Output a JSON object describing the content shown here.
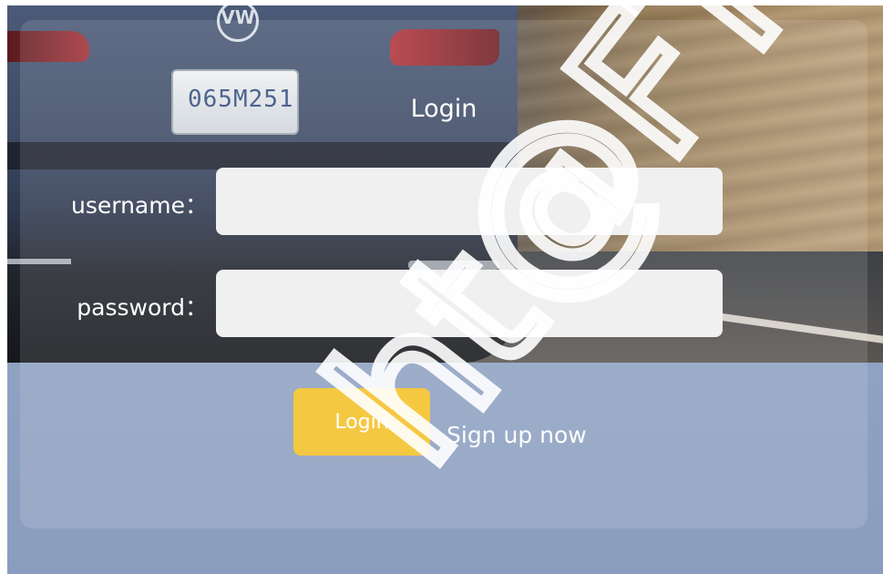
{
  "background": {
    "plate_text": "065M251",
    "emblem_glyph": "VW"
  },
  "login_form": {
    "title": "Login",
    "username_label": "username：",
    "username_value": "",
    "password_label": "password：",
    "password_value": "",
    "login_button_label": "Login",
    "signup_link_label": "Sign up now"
  },
  "colors": {
    "button_accent": "#f5c842",
    "input_background": "#f0f0f0",
    "lower_panel": "#8fa2c2"
  },
  "watermark": {
    "text": "ht@FTSM"
  }
}
